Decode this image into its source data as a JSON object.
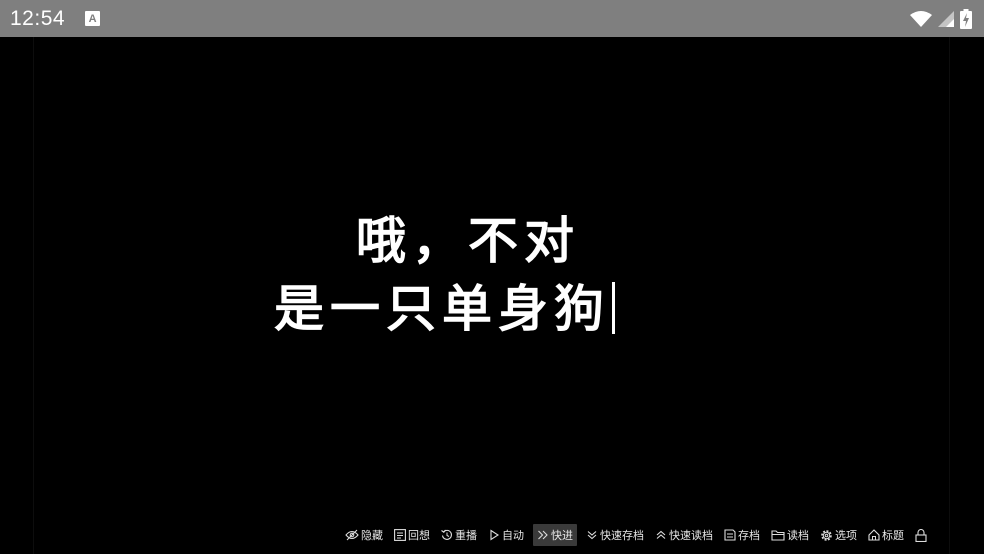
{
  "status_bar": {
    "time": "12:54",
    "notification_glyph": "A"
  },
  "dialogue": {
    "line1": "哦，不对",
    "line2": "是一只单身狗"
  },
  "quick_menu": {
    "items": [
      {
        "label": "隐藏",
        "icon": "eye-off-icon"
      },
      {
        "label": "回想",
        "icon": "history-icon"
      },
      {
        "label": "重播",
        "icon": "replay-icon"
      },
      {
        "label": "自动",
        "icon": "play-icon"
      },
      {
        "label": "快进",
        "icon": "fast-forward-icon",
        "active": true
      },
      {
        "label": "快速存档",
        "icon": "chevron-down-icon"
      },
      {
        "label": "快速读档",
        "icon": "chevron-up-icon"
      },
      {
        "label": "存档",
        "icon": "save-icon"
      },
      {
        "label": "读档",
        "icon": "folder-icon"
      },
      {
        "label": "选项",
        "icon": "gear-icon"
      },
      {
        "label": "标题",
        "icon": "home-icon"
      }
    ],
    "lock_icon": "lock-icon"
  },
  "colors": {
    "status_bar_bg": "#7f7f7f",
    "background": "#000000",
    "text": "#ffffff",
    "menu_active_bg": "#3a3a3a"
  }
}
